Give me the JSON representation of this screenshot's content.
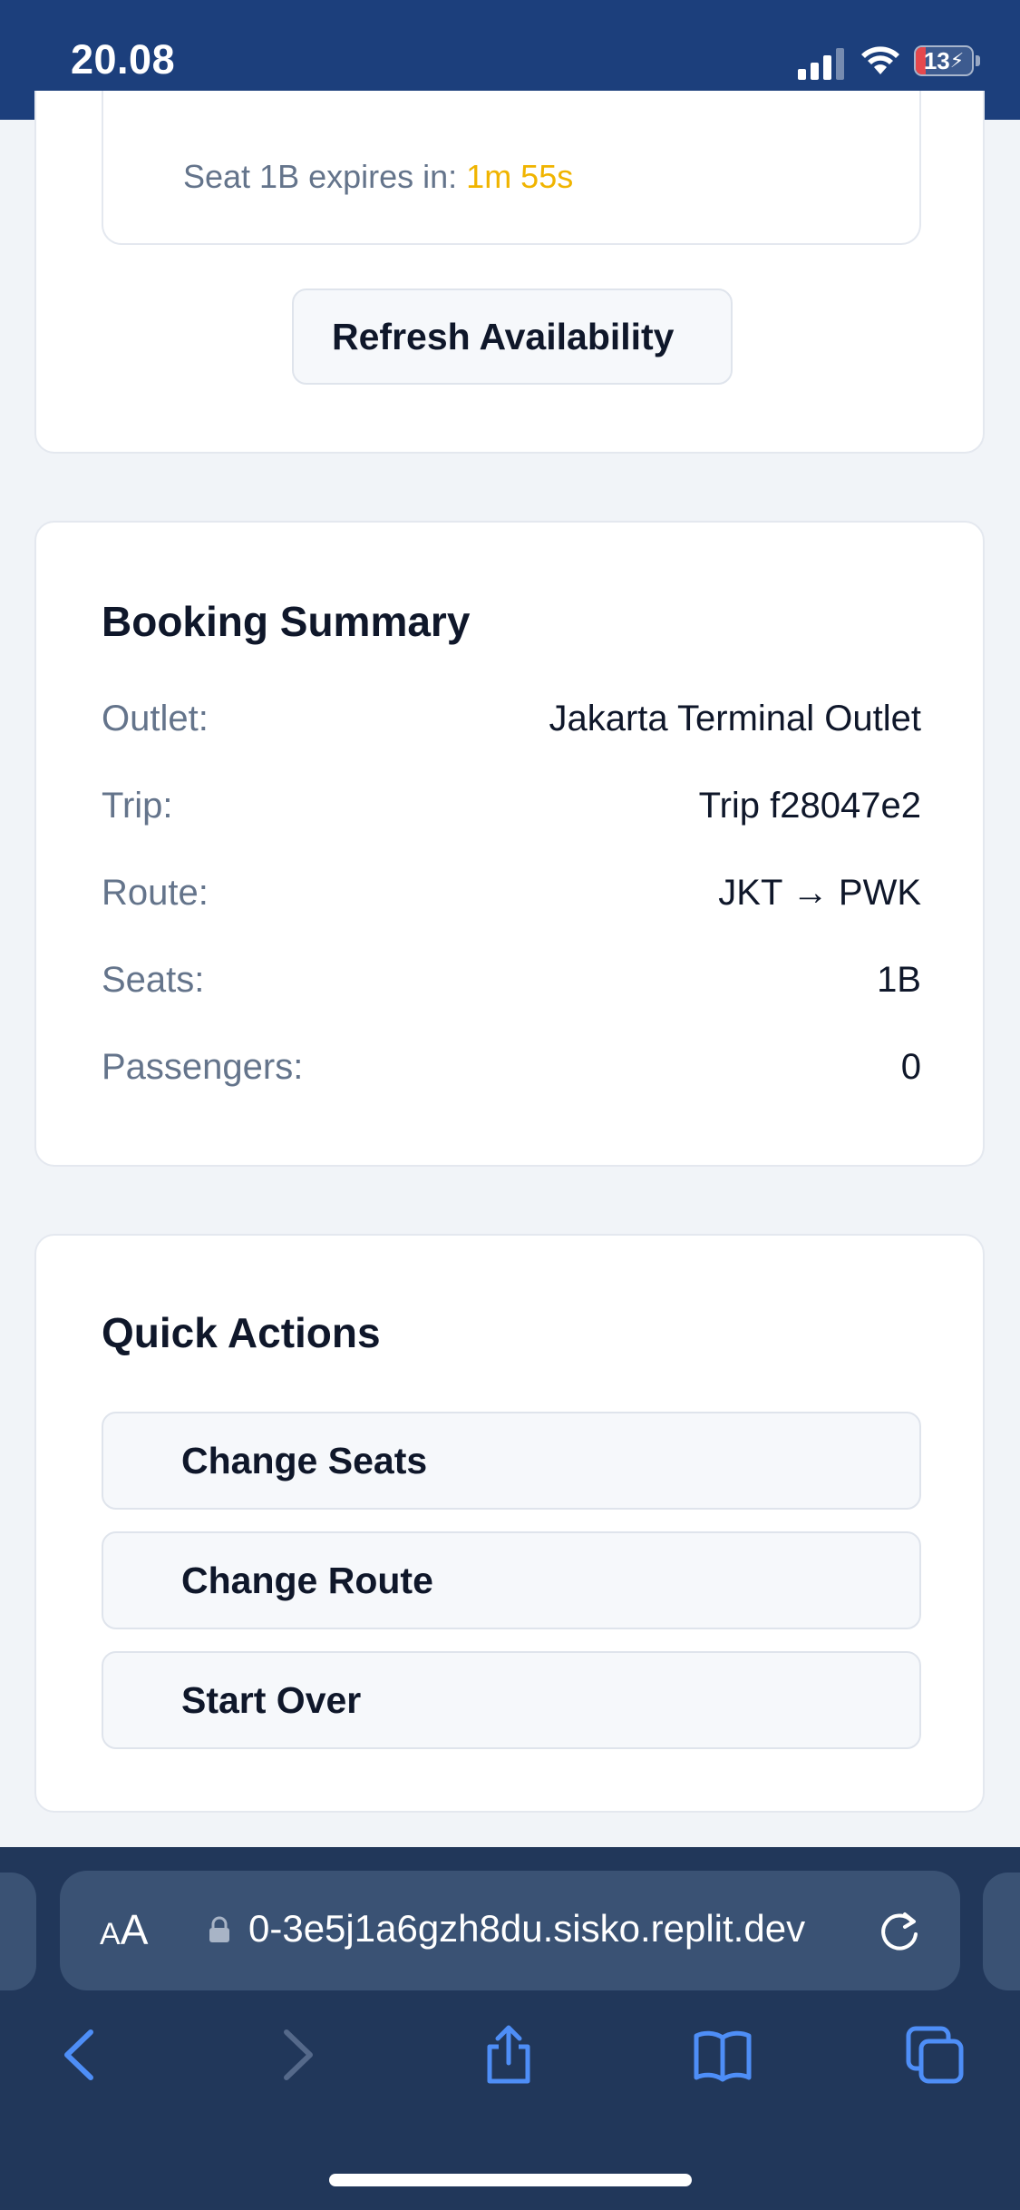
{
  "status_bar": {
    "time": "20.08",
    "battery_level": "13",
    "battery_charging": true,
    "battery_color": "#e5484d"
  },
  "seat_hold": {
    "label": "Seat 1B expires in: ",
    "remaining": "1m 55s",
    "remaining_color": "#f0b400",
    "refresh_label": "Refresh Availability"
  },
  "booking_summary": {
    "title": "Booking Summary",
    "rows": [
      {
        "label": "Outlet:",
        "value": "Jakarta Terminal Outlet"
      },
      {
        "label": "Trip:",
        "value": "Trip f28047e2"
      },
      {
        "label": "Route:",
        "value": "JKT → PWK"
      },
      {
        "label": "Seats:",
        "value": "1B"
      },
      {
        "label": "Passengers:",
        "value": "0"
      }
    ]
  },
  "quick_actions": {
    "title": "Quick Actions",
    "buttons": [
      "Change Seats",
      "Change Route",
      "Start Over"
    ]
  },
  "browser": {
    "aa_small": "A",
    "aa_large": "A",
    "url": "0-3e5j1a6gzh8du.sisko.replit.dev",
    "icons": [
      "back-icon",
      "forward-icon",
      "share-icon",
      "bookmarks-icon",
      "tabs-icon"
    ]
  },
  "colors": {
    "status_bar_bg": "#1c3f7c",
    "browser_bg": "#21375a",
    "page_bg": "#f1f4f8"
  }
}
